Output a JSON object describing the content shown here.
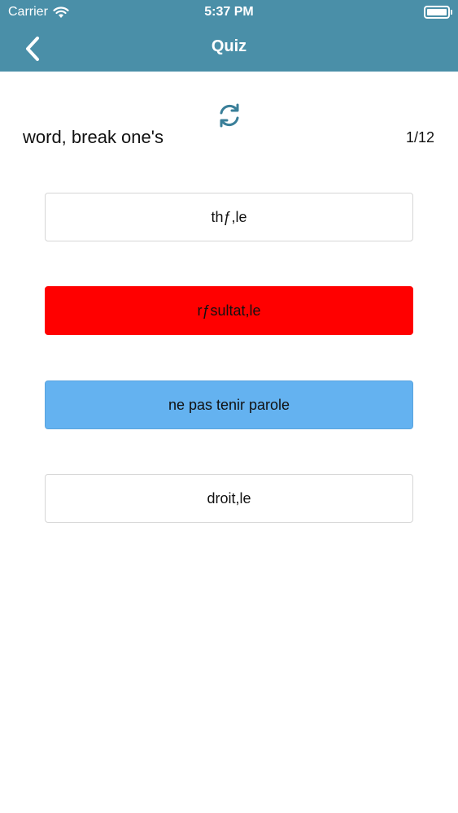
{
  "status_bar": {
    "carrier": "Carrier",
    "time": "5:37 PM"
  },
  "nav": {
    "title": "Quiz"
  },
  "quiz": {
    "question": "word, break one's",
    "counter": "1/12",
    "options": [
      {
        "label": "thƒ,le",
        "state": "default"
      },
      {
        "label": "rƒsultat,le",
        "state": "wrong"
      },
      {
        "label": "ne pas tenir parole",
        "state": "correct"
      },
      {
        "label": "droit,le",
        "state": "default"
      }
    ]
  },
  "colors": {
    "nav_background": "#4a8fa8",
    "wrong": "#ff0000",
    "correct": "#64b2f0",
    "refresh_icon": "#3a7f99"
  }
}
